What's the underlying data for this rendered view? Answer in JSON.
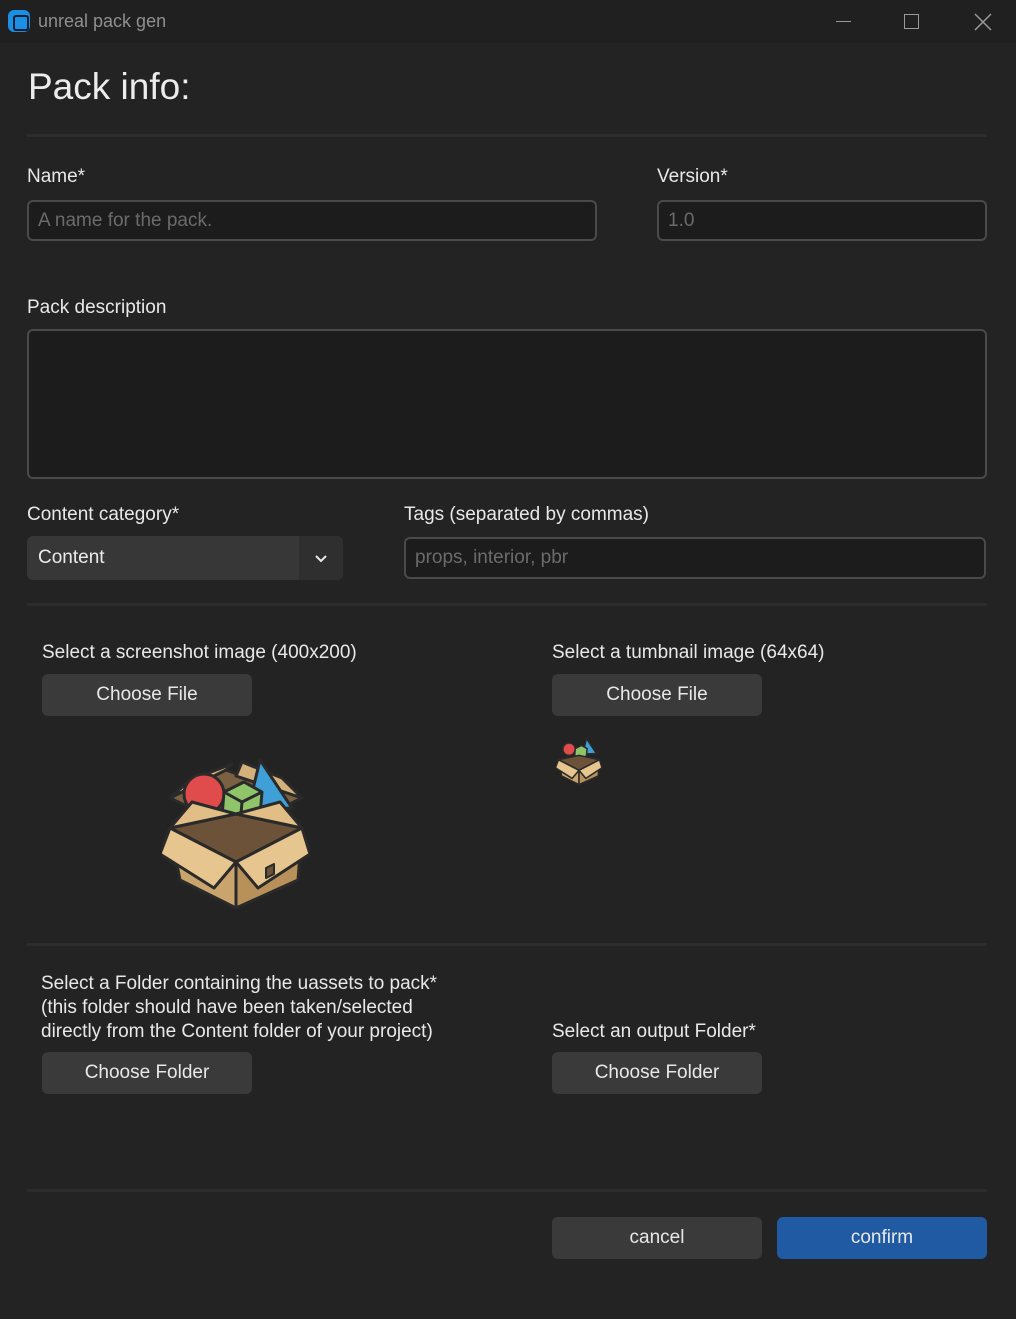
{
  "window": {
    "title": "unreal pack gen",
    "controls": [
      "minimize-icon",
      "maximize-icon",
      "close-icon"
    ]
  },
  "page": {
    "heading": "Pack info:"
  },
  "form": {
    "name_label": "Name*",
    "name_placeholder": "A name for the pack.",
    "version_label": "Version*",
    "version_placeholder": "1.0",
    "description_label": "Pack description",
    "category_label": "Content category*",
    "category_value": "Content",
    "tags_label": "Tags (separated by commas)",
    "tags_placeholder": "props, interior, pbr"
  },
  "images": {
    "screenshot_label": "Select a screenshot image (400x200)",
    "screenshot_button": "Choose File",
    "thumbnail_label": "Select a tumbnail image (64x64)",
    "thumbnail_button": "Choose File",
    "preview_icon": "box-of-shapes-icon"
  },
  "folders": {
    "source_label_line1": "Select a Folder containing the uassets to pack*",
    "source_label_line2": "(this folder should have been taken/selected",
    "source_label_line3": "directly from the Content folder of your project)",
    "source_button": "Choose Folder",
    "output_label": "Select an output Folder*",
    "output_button": "Choose Folder"
  },
  "actions": {
    "cancel": "cancel",
    "confirm": "confirm"
  },
  "colors": {
    "background": "#232323",
    "accent": "#1f5aa3",
    "app_icon": "#1a8fe3"
  }
}
